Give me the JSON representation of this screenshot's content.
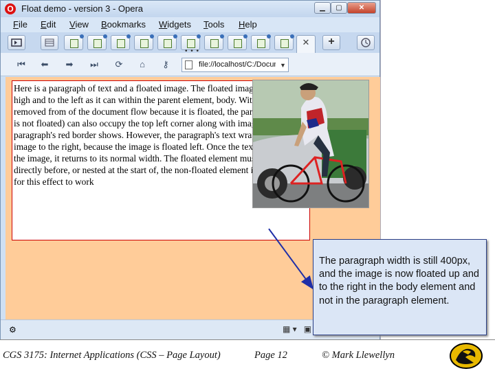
{
  "window": {
    "title": "Float demo - version 3 - Opera",
    "app_logo": "O",
    "controls": [
      "minimize-icon",
      "maximize-icon",
      "close-icon"
    ]
  },
  "menu": [
    "File",
    "Edit",
    "View",
    "Bookmarks",
    "Widgets",
    "Tools",
    "Help"
  ],
  "tabbar": {
    "tab_count": 10,
    "active_tab_close": "✕",
    "new_tab": "+",
    "overflow": "• • •"
  },
  "navbar": {
    "address": "file://localhost/C:/Documents",
    "buttons": [
      "rewind-icon",
      "back-icon",
      "forward-icon",
      "fast-forward-icon",
      "reload-icon",
      "home-icon",
      "key-icon"
    ]
  },
  "page": {
    "paragraph": "Here is a paragraph of text and a floated image. The floated image moves up as high and to the left as it can within the parent element, body. With the image removed from of the document flow because it is floated, the paragraph (which is not floated) can also occupy the top left corner along with image, as the paragraph's red border shows. However, the paragraph's text wraps around the image to the right, because the image is floated left. Once the text gets below the image, it returns to its normal width. The floated element must appear directly before, or nested at the start of, the non-floated element in the markup for this effect to work"
  },
  "callout": {
    "text": "The paragraph width is still 400px, and the image is now floated up and to the right in the body element and not in the paragraph element."
  },
  "footer": {
    "course": "CGS 3175: Internet Applications (CSS – Page Layout)",
    "page": "Page 12",
    "copyright": "© Mark Llewellyn"
  },
  "colors": {
    "body_background": "#ffcc99",
    "paragraph_border": "#cc0000",
    "callout_background": "#dbe6f6",
    "arrow": "#1f2fa8"
  }
}
